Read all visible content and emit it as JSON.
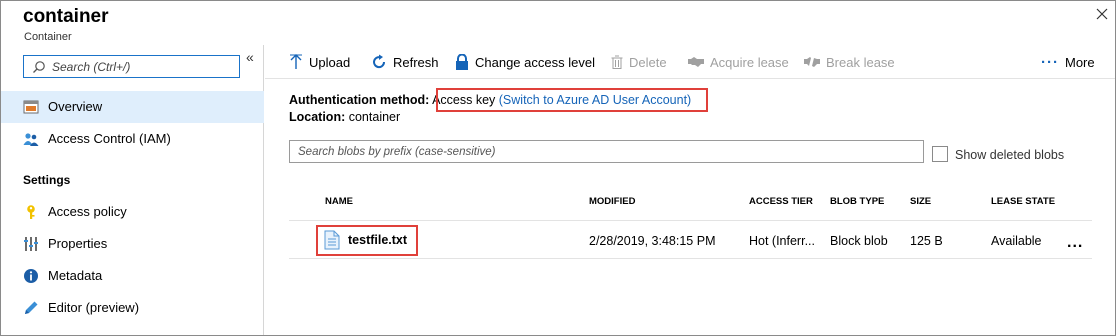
{
  "header": {
    "title": "container",
    "subtitle": "Container"
  },
  "sidebar": {
    "search_placeholder": "Search (Ctrl+/)",
    "collapse_glyph": "«",
    "items": [
      {
        "label": "Overview",
        "icon": "overview-icon"
      },
      {
        "label": "Access Control (IAM)",
        "icon": "people-icon"
      }
    ],
    "section_settings": "Settings",
    "settings_items": [
      {
        "label": "Access policy",
        "icon": "key-icon"
      },
      {
        "label": "Properties",
        "icon": "properties-icon"
      },
      {
        "label": "Metadata",
        "icon": "info-icon"
      },
      {
        "label": "Editor (preview)",
        "icon": "pencil-icon"
      }
    ]
  },
  "toolbar": {
    "upload": "Upload",
    "refresh": "Refresh",
    "change_access": "Change access level",
    "delete": "Delete",
    "acquire_lease": "Acquire lease",
    "break_lease": "Break lease",
    "more": "More"
  },
  "info": {
    "auth_key": "Authentication method:",
    "auth_value": "Access key",
    "auth_link": "(Switch to Azure AD User Account)",
    "location_key": "Location:",
    "location_value": "container"
  },
  "blob_search_placeholder": "Search blobs by prefix (case-sensitive)",
  "show_deleted_label": "Show deleted blobs",
  "table": {
    "headers": [
      "NAME",
      "MODIFIED",
      "ACCESS TIER",
      "BLOB TYPE",
      "SIZE",
      "LEASE STATE"
    ],
    "rows": [
      {
        "name": "testfile.txt",
        "modified": "2/28/2019, 3:48:15 PM",
        "access_tier": "Hot (Inferr...",
        "blob_type": "Block blob",
        "size": "125 B",
        "lease_state": "Available",
        "actions": "..."
      }
    ]
  },
  "colors": {
    "accent": "#1564b8",
    "highlight_border": "#e0403a",
    "active_nav": "#dfeefc"
  }
}
